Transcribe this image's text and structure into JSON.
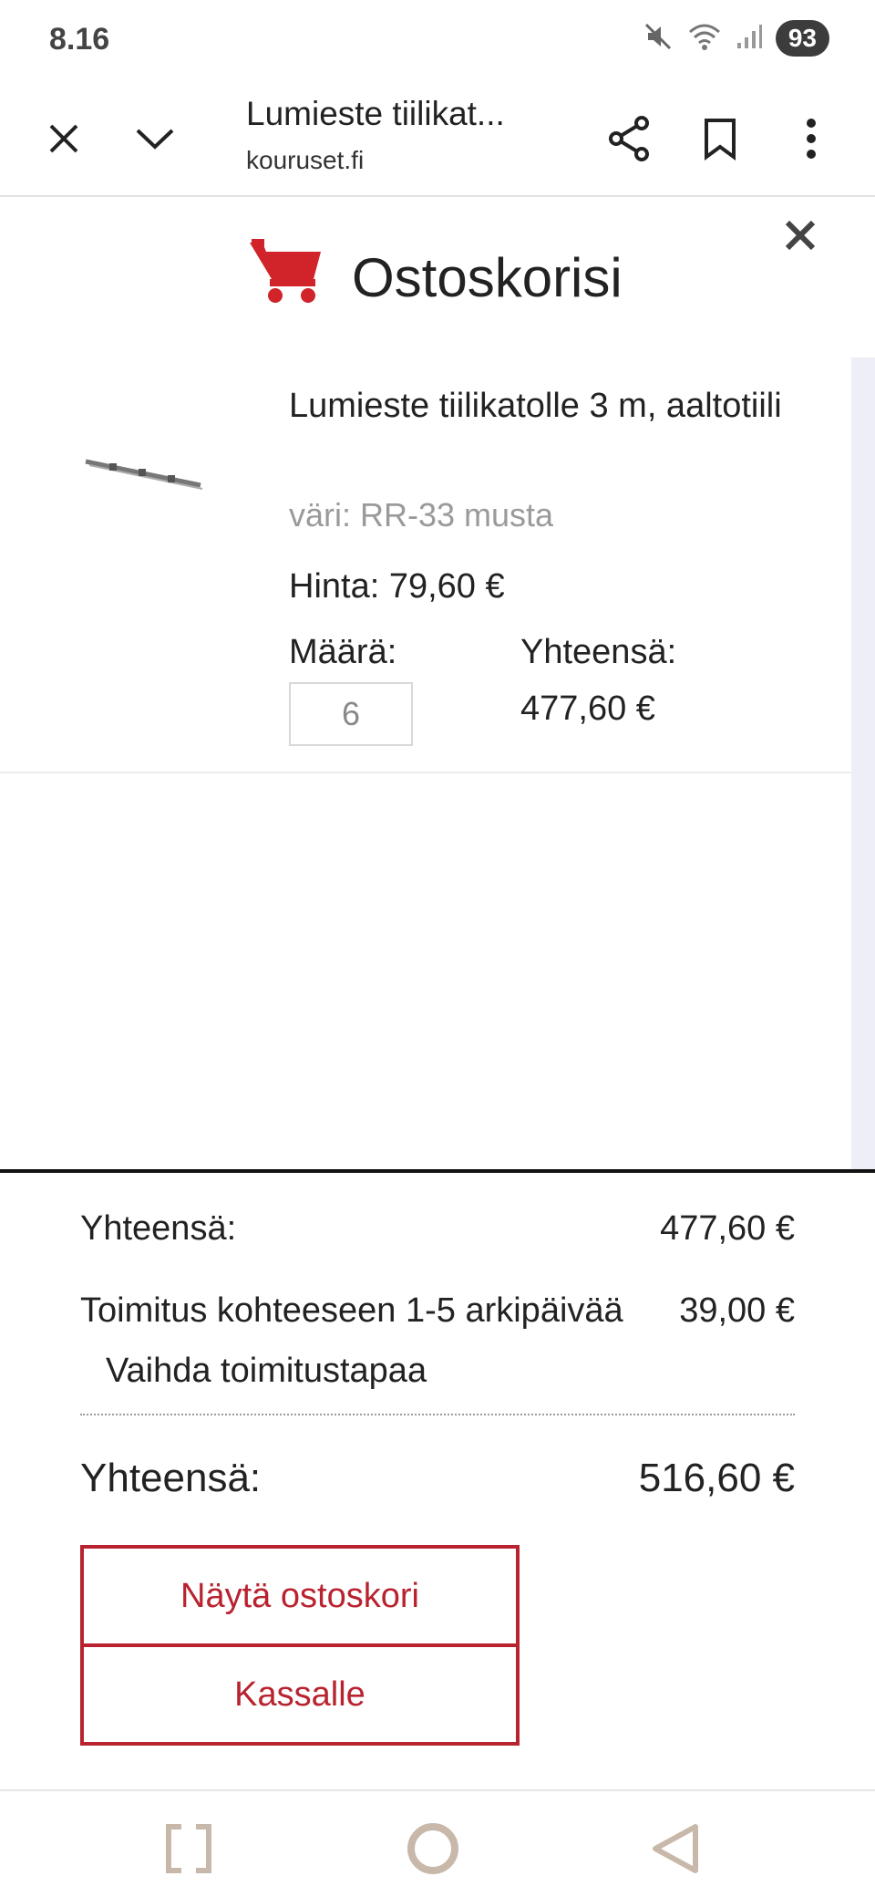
{
  "status_bar": {
    "time": "8.16",
    "battery": "93",
    "icons": [
      "mute-icon",
      "wifi-icon",
      "signal-icon"
    ]
  },
  "browser": {
    "page_title": "Lumieste tiilikat...",
    "url": "kouruset.fi",
    "icons": [
      "close-icon",
      "chevron-down-icon",
      "share-icon",
      "bookmark-icon",
      "more-vert-icon"
    ]
  },
  "cart": {
    "title": "Ostoskorisi",
    "accent_color": "#d0232a",
    "items": [
      {
        "name": "Lumieste tiilikatolle 3 m, aaltotiili",
        "variant": "väri: RR-33 musta",
        "price": "Hinta: 79,60 €",
        "qty_label": "Määrä:",
        "qty_value": "6",
        "line_total_label": "Yhteensä:",
        "line_total_value": "477,60 €"
      }
    ]
  },
  "summary": {
    "subtotal_label": "Yhteensä:",
    "subtotal_value": "477,60 €",
    "shipping_label": "Toimitus kohteeseen 1-5 arkipäivää",
    "shipping_value": "39,00 €",
    "change_shipping": "Vaihda toimitustapaa",
    "total_label": "Yhteensä:",
    "total_value": "516,60 €",
    "view_cart_button": "Näytä ostoskori",
    "checkout_button": "Kassalle"
  },
  "navbar": {
    "icons": [
      "recent-apps-icon",
      "home-icon",
      "back-icon"
    ]
  }
}
